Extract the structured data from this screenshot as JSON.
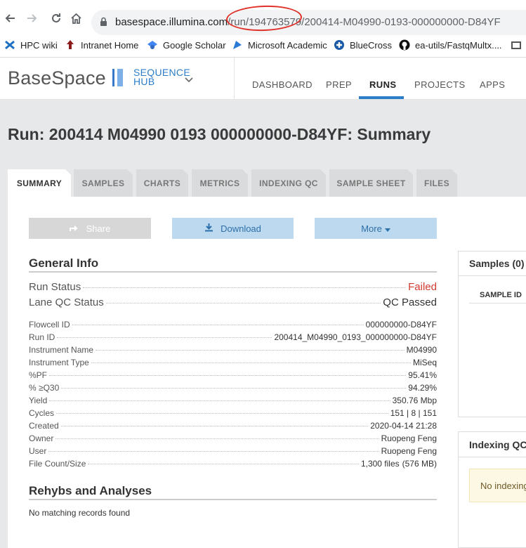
{
  "browser": {
    "url_domain": "basespace.illumina.com",
    "url_path": "/run/194763579/200414-M04990-0193-000000000-D84YF",
    "bookmarks": [
      {
        "label": "HPC wiki",
        "icon": "hpc-wiki-icon"
      },
      {
        "label": "Intranet Home",
        "icon": "intranet-icon"
      },
      {
        "label": "Google Scholar",
        "icon": "google-scholar-icon"
      },
      {
        "label": "Microsoft Academic",
        "icon": "microsoft-academic-icon"
      },
      {
        "label": "BlueCross",
        "icon": "bluecross-icon"
      },
      {
        "label": "ea-utils/FastqMultx....",
        "icon": "github-icon"
      }
    ],
    "annotation_color": "#e0322a"
  },
  "app": {
    "logo": "BaseSpace",
    "hub_line1": "SEQUENCE",
    "hub_line2": "HUB",
    "nav": [
      "DASHBOARD",
      "PREP",
      "RUNS",
      "PROJECTS",
      "APPS"
    ],
    "active_nav": "RUNS",
    "accent_color": "#2d7ec8"
  },
  "page": {
    "title": "Run: 200414 M04990 0193 000000000-D84YF: Summary",
    "tabs": [
      "SUMMARY",
      "SAMPLES",
      "CHARTS",
      "METRICS",
      "INDEXING QC",
      "SAMPLE SHEET",
      "FILES"
    ],
    "active_tab": "SUMMARY"
  },
  "actions": {
    "share": "Share",
    "download": "Download",
    "more": "More"
  },
  "general_info": {
    "title": "General Info",
    "status": [
      {
        "label": "Run Status",
        "value": "Failed"
      },
      {
        "label": "Lane QC Status",
        "value": "QC Passed"
      }
    ],
    "details": [
      {
        "label": "Flowcell ID",
        "value": "000000000-D84YF"
      },
      {
        "label": "Run ID",
        "value": "200414_M04990_0193_000000000-D84YF"
      },
      {
        "label": "Instrument Name",
        "value": "M04990"
      },
      {
        "label": "Instrument Type",
        "value": "MiSeq"
      },
      {
        "label": "%PF",
        "value": "95.41%"
      },
      {
        "label": "% ≥Q30",
        "value": "94.29%"
      },
      {
        "label": "Yield",
        "value": "350.76 Mbp"
      },
      {
        "label": "Cycles",
        "value": "151 | 8 | 151"
      },
      {
        "label": "Created",
        "value": "2020-04-14 21:28"
      },
      {
        "label": "Owner",
        "value": "Ruopeng Feng"
      },
      {
        "label": "User",
        "value": "Ruopeng Feng"
      }
    ],
    "file_count_label": "File Count/Size",
    "file_count_link": "1,300 files",
    "file_size": "(576 MB)"
  },
  "rehybs": {
    "title": "Rehybs and Analyses",
    "empty": "No matching records found"
  },
  "samples_panel": {
    "title": "Samples (0)",
    "column": "SAMPLE ID"
  },
  "indexing_panel": {
    "title": "Indexing QC",
    "note": "No indexing"
  },
  "status_colors": {
    "failed": "#d13a2f"
  }
}
